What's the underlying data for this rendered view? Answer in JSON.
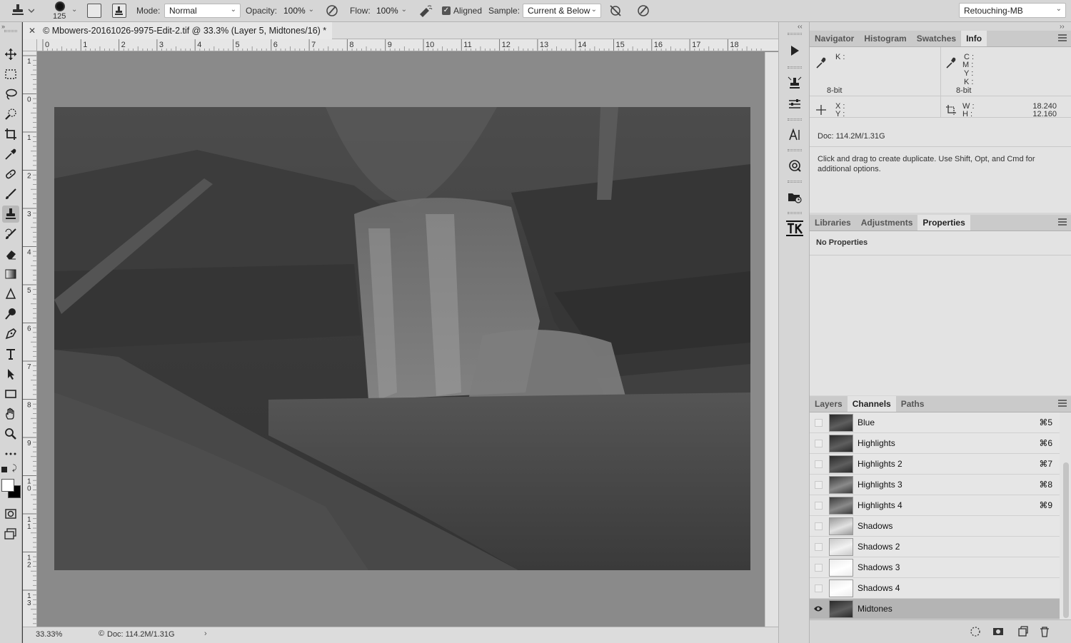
{
  "options_bar": {
    "brush_size": "125",
    "mode_label": "Mode:",
    "mode_value": "Normal",
    "opacity_label": "Opacity:",
    "opacity_value": "100%",
    "flow_label": "Flow:",
    "flow_value": "100%",
    "aligned_label": "Aligned",
    "aligned_checked": true,
    "sample_label": "Sample:",
    "sample_value": "Current & Below",
    "workspace_value": "Retouching-MB"
  },
  "document": {
    "tab_title": "© Mbowers-20161026-9975-Edit-2.tif @ 33.3% (Layer 5, Midtones/16) *",
    "ruler_h": [
      "0",
      "1",
      "2",
      "3",
      "4",
      "5",
      "6",
      "7",
      "8",
      "9",
      "10",
      "11",
      "12",
      "13",
      "14",
      "15",
      "16",
      "17",
      "18"
    ],
    "ruler_v": [
      "1",
      "0",
      "1",
      "2",
      "3",
      "4",
      "5",
      "6",
      "7",
      "8",
      "9",
      "1 0",
      "1 1",
      "1 2",
      "1 3"
    ],
    "zoom": "33.33%",
    "doc_size": "Doc: 114.2M/1.31G"
  },
  "info_panel": {
    "tabs": [
      "Navigator",
      "Histogram",
      "Swatches",
      "Info"
    ],
    "active_tab": "Info",
    "left_k_label": "K :",
    "left_bit": "8-bit",
    "right_cmyk_labels": [
      "C :",
      "M :",
      "Y :",
      "K :"
    ],
    "right_bit": "8-bit",
    "x_label": "X :",
    "y_label": "Y :",
    "w_label": "W :",
    "h_label": "H :",
    "w_value": "18.240",
    "h_value": "12.160",
    "doc": "Doc: 114.2M/1.31G",
    "hint": "Click and drag to create duplicate.  Use Shift, Opt, and Cmd for additional options."
  },
  "properties_panel": {
    "tabs": [
      "Libraries",
      "Adjustments",
      "Properties"
    ],
    "active_tab": "Properties",
    "message": "No Properties"
  },
  "channels_panel": {
    "tabs": [
      "Layers",
      "Channels",
      "Paths"
    ],
    "active_tab": "Channels",
    "rows": [
      {
        "name": "Blue",
        "shortcut": "⌘5",
        "visible": false,
        "thumb": "dark"
      },
      {
        "name": "Highlights",
        "shortcut": "⌘6",
        "visible": false,
        "thumb": "dark"
      },
      {
        "name": "Highlights 2",
        "shortcut": "⌘7",
        "visible": false,
        "thumb": "dark"
      },
      {
        "name": "Highlights 3",
        "shortcut": "⌘8",
        "visible": false,
        "thumb": "mid"
      },
      {
        "name": "Highlights 4",
        "shortcut": "⌘9",
        "visible": false,
        "thumb": "mid"
      },
      {
        "name": "Shadows",
        "shortcut": "",
        "visible": false,
        "thumb": "light"
      },
      {
        "name": "Shadows 2",
        "shortcut": "",
        "visible": false,
        "thumb": "lighter"
      },
      {
        "name": "Shadows 3",
        "shortcut": "",
        "visible": false,
        "thumb": "white"
      },
      {
        "name": "Shadows 4",
        "shortcut": "",
        "visible": false,
        "thumb": "white"
      },
      {
        "name": "Midtones",
        "shortcut": "",
        "visible": true,
        "thumb": "dark",
        "selected": true
      }
    ]
  },
  "colors": {
    "chrome": "#d6d6d6",
    "panel_body": "#e3e3e3",
    "canvas_bg": "#8a8a8a",
    "selected_row": "#b4b4b4"
  }
}
